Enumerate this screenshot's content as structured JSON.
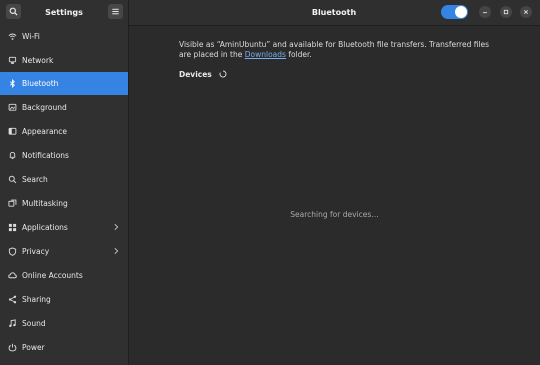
{
  "header": {
    "app_title": "Settings",
    "page_title": "Bluetooth",
    "bluetooth_enabled": true,
    "accent_color": "#3584e4"
  },
  "sidebar": {
    "items": [
      {
        "label": "Wi-Fi",
        "icon": "wifi-icon"
      },
      {
        "label": "Network",
        "icon": "network-icon"
      },
      {
        "label": "Bluetooth",
        "icon": "bluetooth-icon",
        "active": true
      },
      {
        "label": "Background",
        "icon": "background-icon"
      },
      {
        "label": "Appearance",
        "icon": "appearance-icon"
      },
      {
        "label": "Notifications",
        "icon": "bell-icon"
      },
      {
        "label": "Search",
        "icon": "search-icon"
      },
      {
        "label": "Multitasking",
        "icon": "multitasking-icon"
      },
      {
        "label": "Applications",
        "icon": "applications-icon",
        "has_submenu": true
      },
      {
        "label": "Privacy",
        "icon": "privacy-icon",
        "has_submenu": true
      },
      {
        "label": "Online Accounts",
        "icon": "cloud-icon"
      },
      {
        "label": "Sharing",
        "icon": "share-icon"
      },
      {
        "label": "Sound",
        "icon": "music-note-icon"
      },
      {
        "label": "Power",
        "icon": "power-icon"
      }
    ]
  },
  "main": {
    "info_prefix": "Visible as “AminUbuntu” and available for Bluetooth file transfers. Transferred files are placed in the ",
    "info_link": "Downloads",
    "info_suffix": " folder.",
    "devices_label": "Devices",
    "searching_text": "Searching for devices…"
  }
}
